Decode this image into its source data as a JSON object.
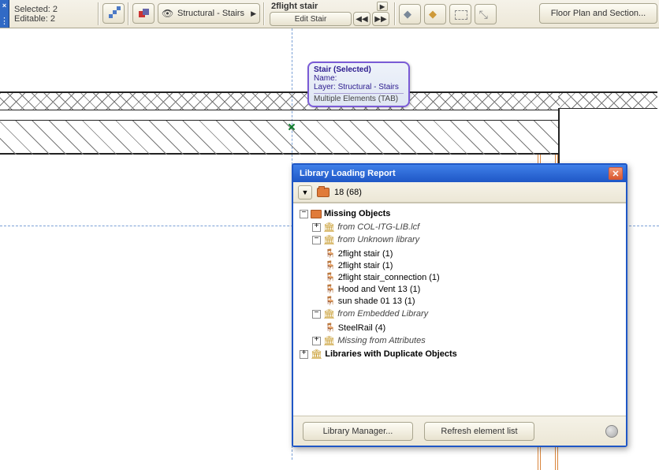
{
  "toolbar": {
    "selected_label": "Selected: 2",
    "editable_label": "Editable: 2",
    "layer_label": "Structural - Stairs",
    "edit_group_title": "2flight stair",
    "edit_button": "Edit Stair",
    "floor_plan_button": "Floor Plan and Section..."
  },
  "tooltip": {
    "title": "Stair (Selected)",
    "name_label": "Name:",
    "layer_label": "Layer:",
    "layer_value": "Structural - Stairs",
    "multi_hint": "Multiple Elements (TAB)"
  },
  "dialog": {
    "title": "Library Loading Report",
    "summary": "18 (68)",
    "library_manager_button": "Library Manager...",
    "refresh_button": "Refresh element list",
    "tree": {
      "missing_objects": "Missing Objects",
      "source_col": "from COL-ITG-LIB.lcf",
      "source_unknown": "from Unknown library",
      "items_unknown": [
        "2flight stair (1)",
        "2flight stair (1)",
        "2flight stair_connection (1)",
        "Hood and Vent 13 (1)",
        "sun shade 01 13 (1)"
      ],
      "source_embedded": "from Embedded Library",
      "items_embedded": [
        "SteelRail (4)"
      ],
      "missing_attrs": "Missing from Attributes",
      "duplicates": "Libraries with Duplicate Objects"
    }
  }
}
